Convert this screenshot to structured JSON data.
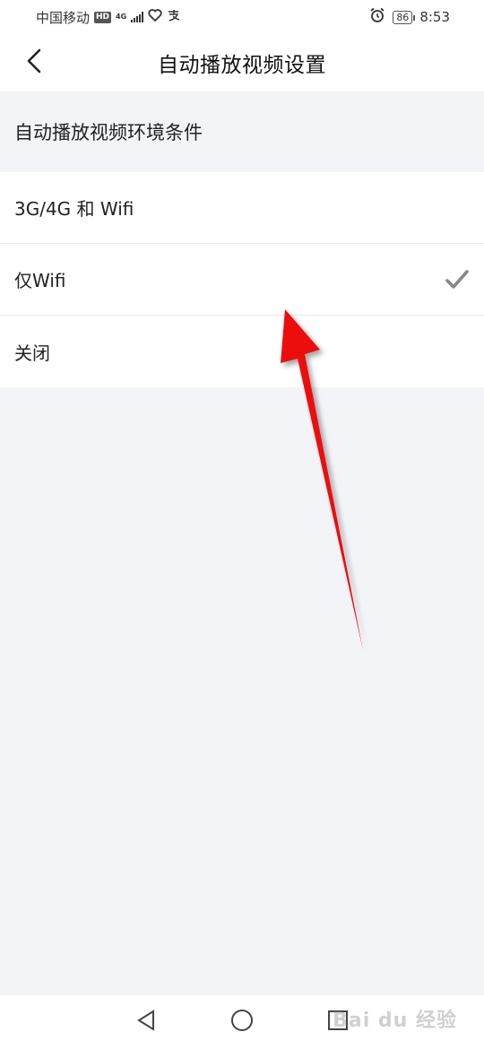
{
  "status_bar": {
    "carrier": "中国移动",
    "hd_badge": "HD",
    "network": "4G",
    "time": "8:53",
    "battery": "86"
  },
  "header": {
    "title": "自动播放视频设置"
  },
  "section": {
    "title": "自动播放视频环境条件"
  },
  "options": [
    {
      "label": "3G/4G 和 Wifi",
      "selected": false
    },
    {
      "label": "仅Wifi",
      "selected": true
    },
    {
      "label": "关闭",
      "selected": false
    }
  ],
  "watermark": "Bai du 经验",
  "colors": {
    "accent_arrow": "#ee1111",
    "check": "#888888",
    "background": "#f3f4f8"
  }
}
